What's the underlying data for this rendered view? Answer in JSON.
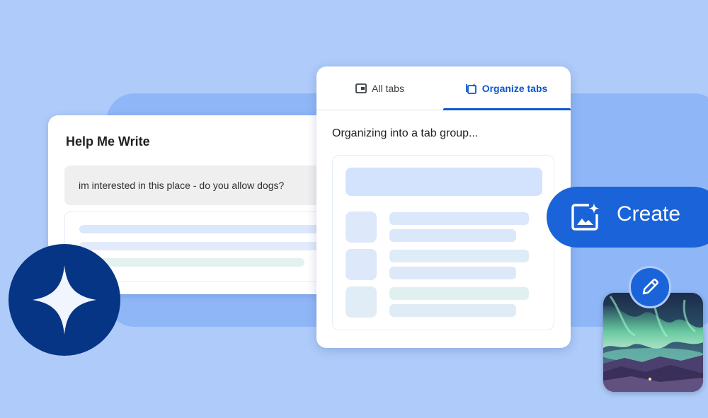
{
  "help_me_write": {
    "title": "Help Me Write",
    "prompt": "im interested in this place - do you allow dogs?"
  },
  "tabs_panel": {
    "tabs": [
      {
        "label": "All tabs",
        "icon": "tab-icon",
        "selected": false
      },
      {
        "label": "Organize tabs",
        "icon": "tab-sparkle-icon",
        "selected": true
      }
    ],
    "status": "Organizing into a tab group..."
  },
  "create_button": {
    "label": "Create",
    "icon": "image-sparkle-icon"
  },
  "icons": {
    "gemini": "sparkle-star-icon",
    "edit": "pencil-icon"
  },
  "colors": {
    "background": "#aecbfa",
    "accent_blue": "#1a63d8",
    "tab_active": "#0b57d0",
    "gemini_badge": "#063585"
  }
}
